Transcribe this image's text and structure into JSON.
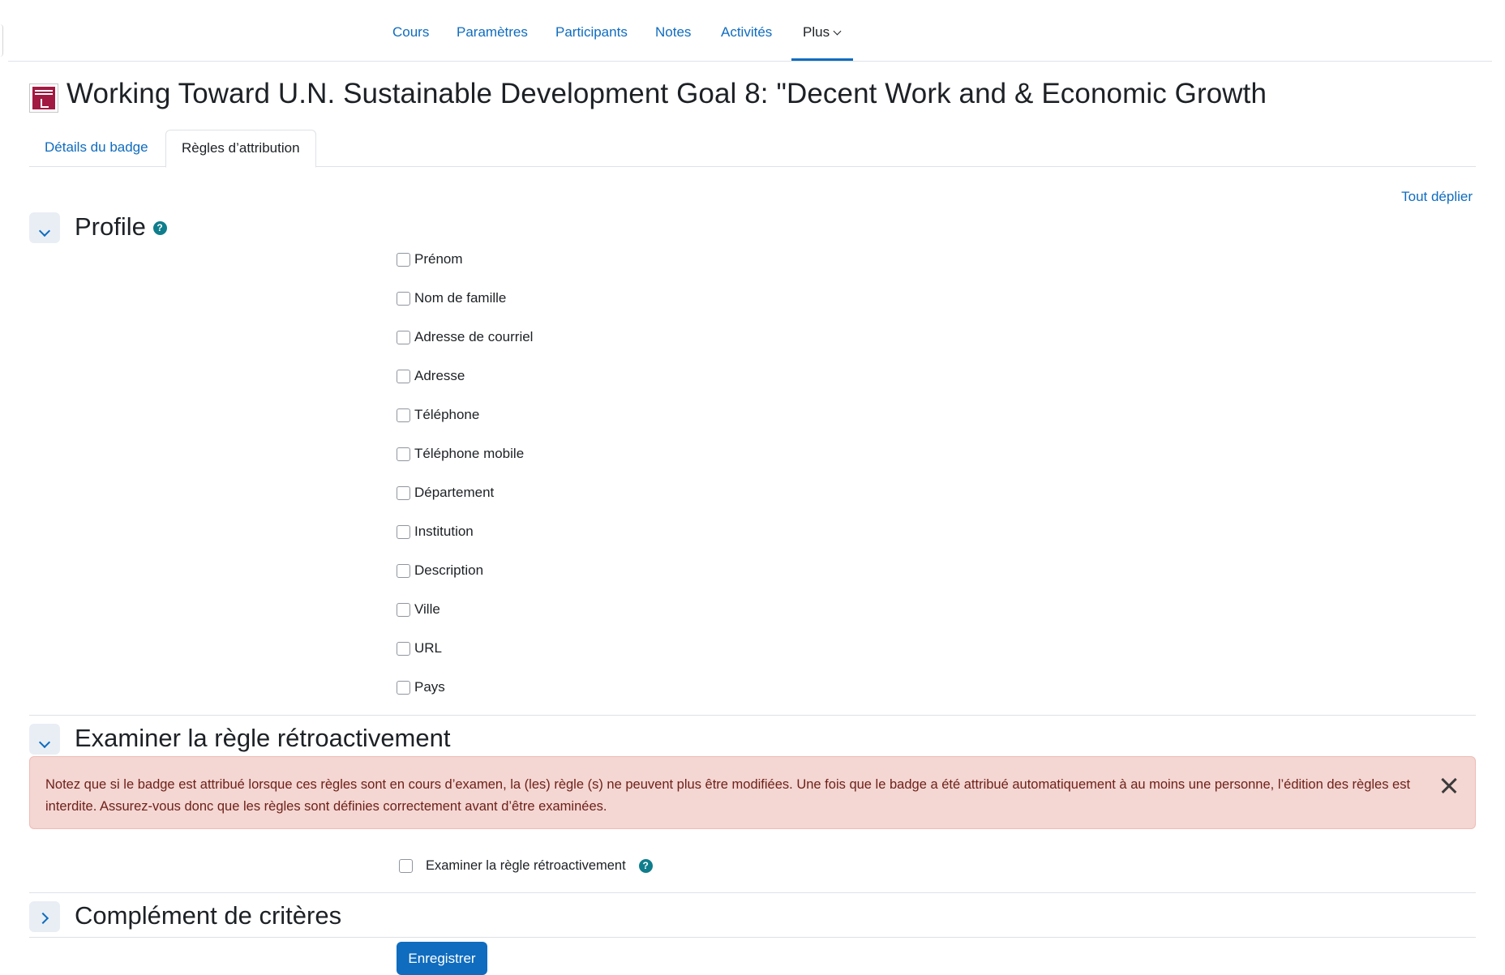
{
  "topnav": {
    "items": [
      "Cours",
      "Paramètres",
      "Participants",
      "Notes",
      "Activités"
    ],
    "more": "Plus"
  },
  "header": {
    "title": "Working Toward U.N. Sustainable Development Goal 8: \"Decent Work and & Economic Growth"
  },
  "tabs": [
    "Détails du badge",
    "Règles d’attribution"
  ],
  "expand_all": "Tout déplier",
  "profile": {
    "title": "Profile",
    "fields": [
      "Prénom",
      "Nom de famille",
      "Adresse de courriel",
      "Adresse",
      "Téléphone",
      "Téléphone mobile",
      "Département",
      "Institution",
      "Description",
      "Ville",
      "URL",
      "Pays"
    ]
  },
  "review": {
    "title": "Examiner la règle rétroactivement",
    "alert": "Notez que si le badge est attribué lorsque ces règles sont en cours d’examen, la (les) règle (s) ne peuvent plus être modifiées. Une fois que le badge a été attribué automatiquement à au moins une personne, l’édition des règles est interdite. Assurez-vous donc que les règles sont définies correctement avant d’être examinées.",
    "checkbox_label": "Examiner la règle rétroactivement"
  },
  "complement": {
    "title": "Complément de critères"
  },
  "save_label": "Enregistrer",
  "colors": {
    "link": "#0f6cbf",
    "alert_bg": "#f4d6d2",
    "help": "#0f7d8c"
  }
}
